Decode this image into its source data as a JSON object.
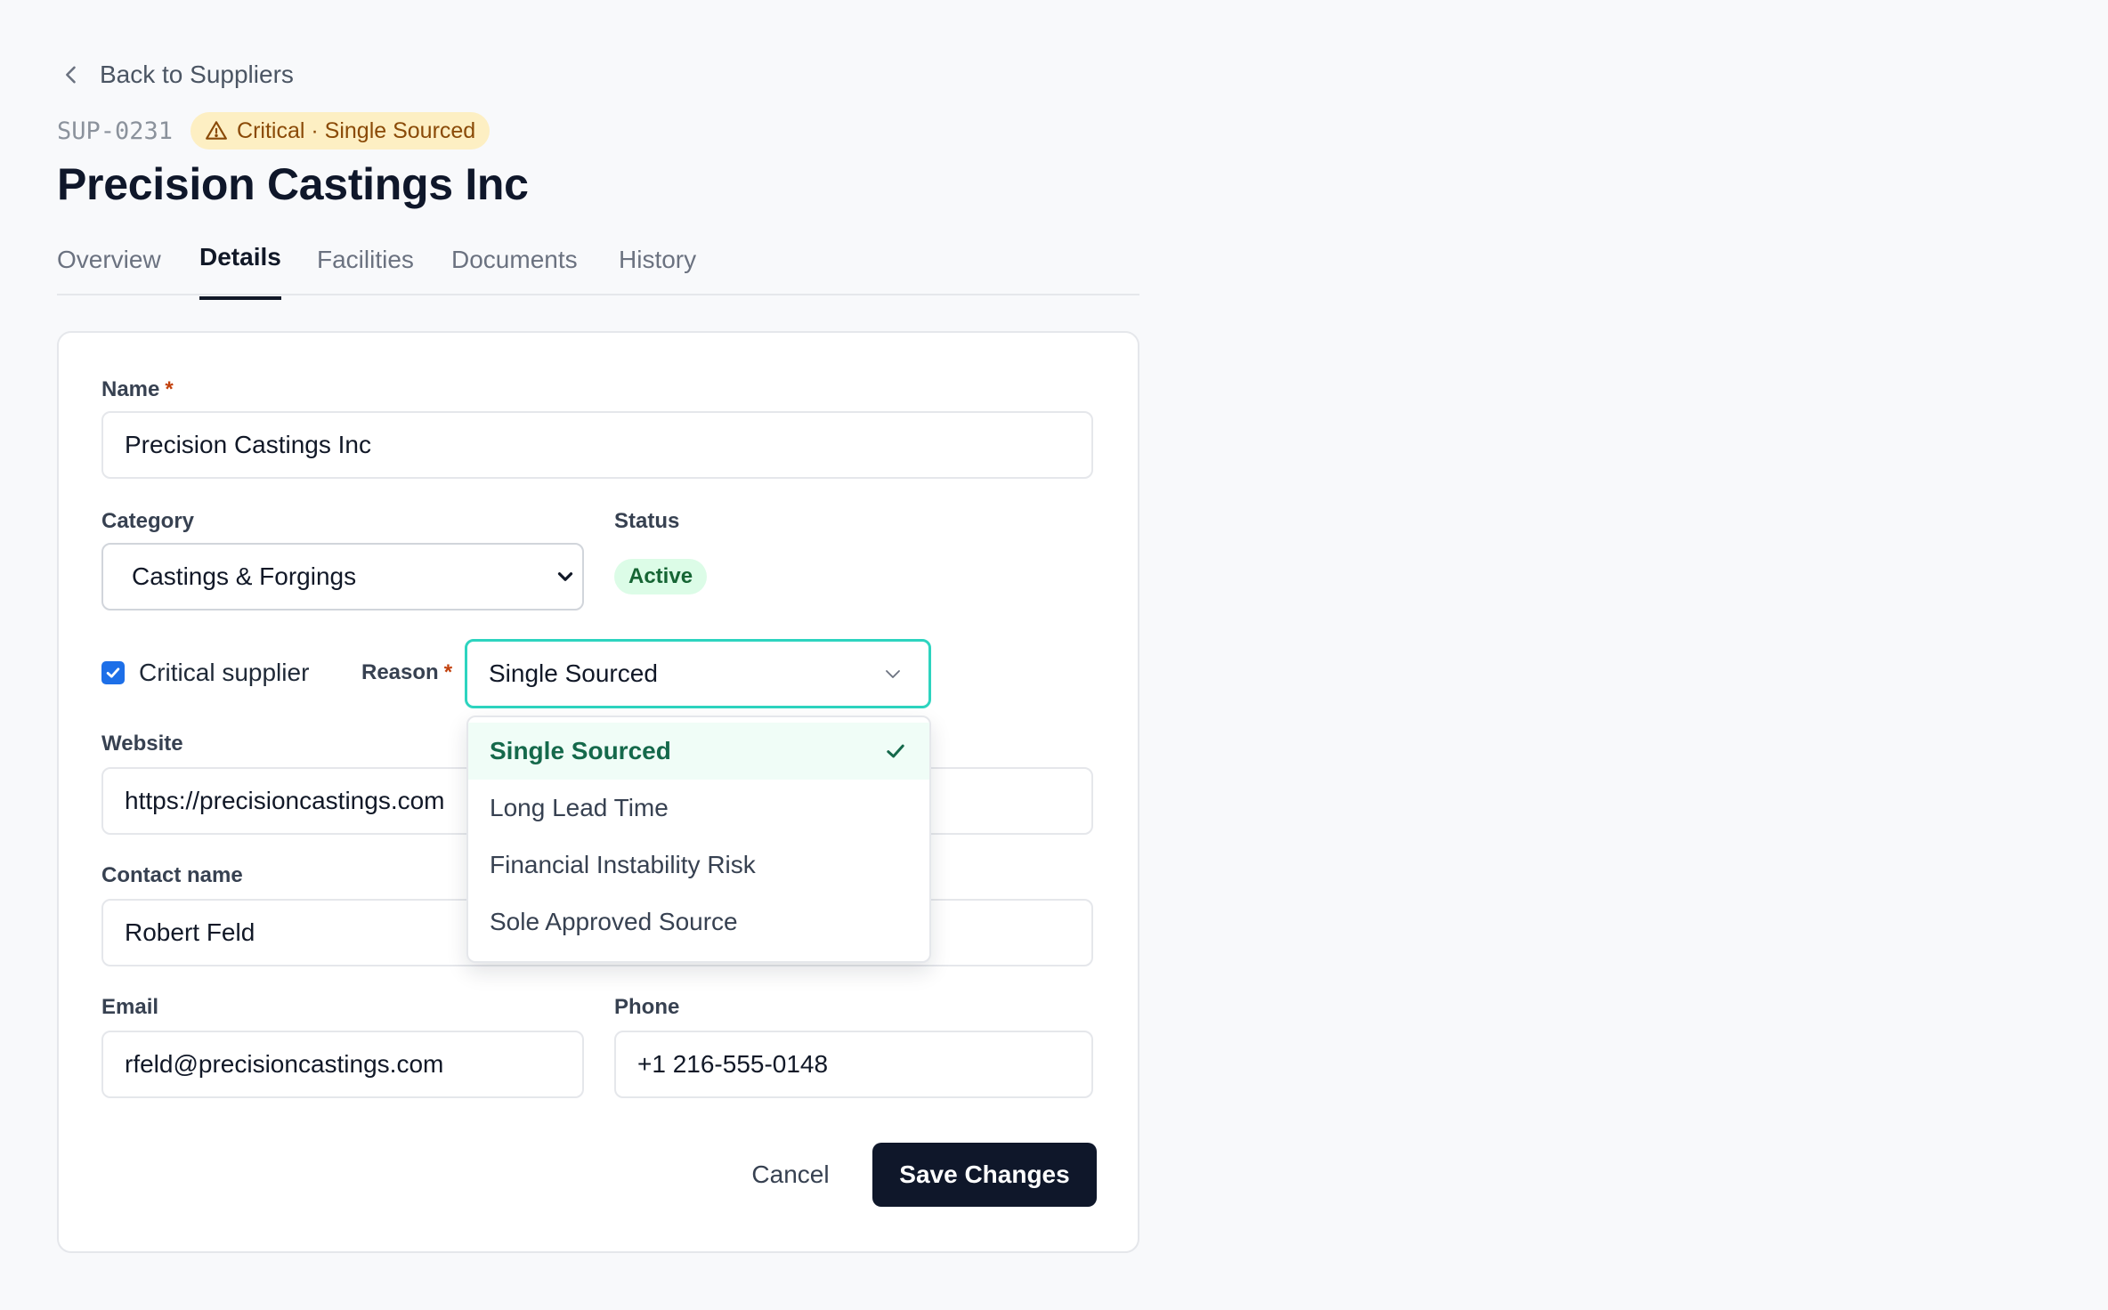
{
  "nav": {
    "back_label": "Back to Suppliers"
  },
  "supplier": {
    "id": "SUP-0231",
    "critical_badge": "Critical · Single Sourced",
    "name": "Precision Castings Inc"
  },
  "tabs": [
    {
      "label": "Overview",
      "active": false
    },
    {
      "label": "Details",
      "active": true
    },
    {
      "label": "Facilities",
      "active": false
    },
    {
      "label": "Documents",
      "active": false
    },
    {
      "label": "History",
      "active": false
    }
  ],
  "form": {
    "name_label": "Name",
    "required_mark": "*",
    "name_value": "Precision Castings Inc",
    "category_label": "Category",
    "category_value": "Castings & Forgings",
    "status_label": "Status",
    "status_value": "Active",
    "critical_label": "Critical supplier",
    "critical_checked": true,
    "reason_label": "Reason",
    "reason_value": "Single Sourced",
    "reason_options": [
      {
        "label": "Single Sourced",
        "selected": true
      },
      {
        "label": "Long Lead Time",
        "selected": false
      },
      {
        "label": "Financial Instability Risk",
        "selected": false
      },
      {
        "label": "Sole Approved Source",
        "selected": false
      }
    ],
    "website_label": "Website",
    "website_value": "https://precisioncastings.com",
    "contact_label": "Contact name",
    "contact_value": "Robert Feld",
    "email_label": "Email",
    "email_value": "rfeld@precisioncastings.com",
    "phone_label": "Phone",
    "phone_value": "+1 216-555-0148"
  },
  "actions": {
    "cancel_label": "Cancel",
    "save_label": "Save Changes"
  },
  "colors": {
    "accent_focus": "#2dd4bf",
    "primary_button": "#0f172a",
    "critical_badge_bg": "#fdefc3",
    "status_active_bg": "#dcfce7",
    "checkbox": "#1d6fe8"
  }
}
